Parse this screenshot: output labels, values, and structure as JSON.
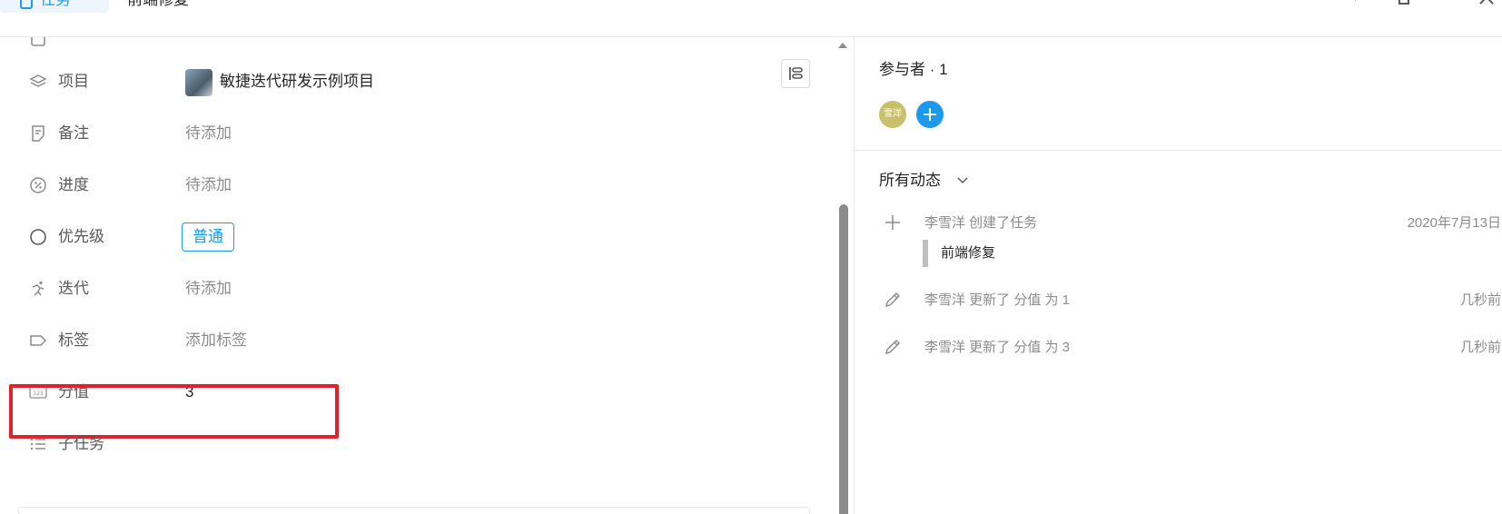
{
  "header": {
    "tab_label": "任务",
    "task_title": "前端修复"
  },
  "fields": {
    "project": {
      "label": "项目",
      "value": "敏捷迭代研发示例项目"
    },
    "note": {
      "label": "备注",
      "value": "待添加"
    },
    "progress": {
      "label": "进度",
      "value": "待添加"
    },
    "priority": {
      "label": "优先级",
      "value": "普通"
    },
    "iteration": {
      "label": "迭代",
      "value": "待添加"
    },
    "tags": {
      "label": "标签",
      "value": "添加标签"
    },
    "score": {
      "label": "分值",
      "value": "3"
    },
    "subtasks": {
      "label": "子任务"
    }
  },
  "participants": {
    "title": "参与者 · 1",
    "avatar_text": "雪洋"
  },
  "activity": {
    "filter_label": "所有动态",
    "items": [
      {
        "text": "李雪洋 创建了任务",
        "time": "2020年7月13日",
        "icon": "plus-icon",
        "quote": "前端修复"
      },
      {
        "text": "李雪洋 更新了 分值 为 1",
        "time": "几秒前",
        "icon": "pencil-icon"
      },
      {
        "text": "李雪洋 更新了 分值 为 3",
        "time": "几秒前",
        "icon": "pencil-icon"
      }
    ]
  },
  "colors": {
    "accent": "#1b9aee",
    "highlight": "#e3212b",
    "avatar": "#c9c06d"
  }
}
